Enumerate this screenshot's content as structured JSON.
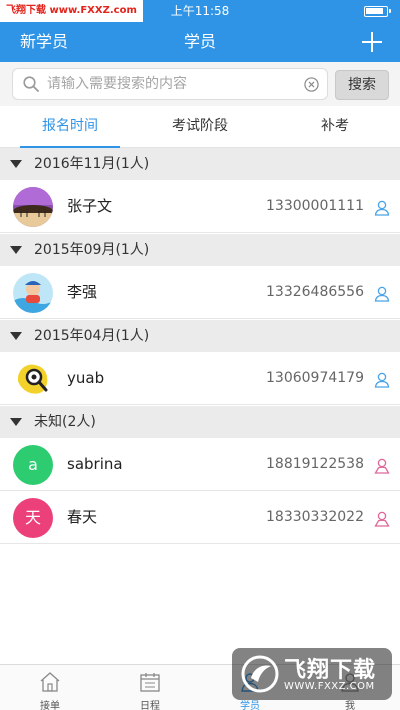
{
  "status_bar": {
    "watermark_text": "飞翔下载 www.FXXZ.com",
    "time": "上午11:58"
  },
  "nav": {
    "left_label": "新学员",
    "title": "学员",
    "add_icon": "plus-icon"
  },
  "search": {
    "placeholder": "请输入需要搜索的内容",
    "value": "",
    "button_label": "搜索"
  },
  "tabs": [
    {
      "label": "报名时间",
      "active": true
    },
    {
      "label": "考试阶段",
      "active": false
    },
    {
      "label": "补考",
      "active": false
    }
  ],
  "groups": [
    {
      "header": "2016年11月(1人)",
      "students": [
        {
          "name": "张子文",
          "phone": "13300001111",
          "gender_icon": "male-person-icon",
          "avatar": "photo"
        }
      ]
    },
    {
      "header": "2015年09月(1人)",
      "students": [
        {
          "name": "李强",
          "phone": "13326486556",
          "gender_icon": "male-person-icon",
          "avatar": "photo"
        }
      ]
    },
    {
      "header": "2015年04月(1人)",
      "students": [
        {
          "name": "yuab",
          "phone": "13060974179",
          "gender_icon": "male-person-icon",
          "avatar": "photo"
        }
      ]
    },
    {
      "header": "未知(2人)",
      "students": [
        {
          "name": "sabrina",
          "phone": "18819122538",
          "gender_icon": "female-person-icon",
          "avatar_letter": "a",
          "avatar_color": "#2ecc71"
        },
        {
          "name": "春天",
          "phone": "18330332022",
          "gender_icon": "female-person-icon",
          "avatar_letter": "天",
          "avatar_color": "#ec407a"
        }
      ]
    }
  ],
  "bottom_tabs": [
    {
      "label": "接单",
      "icon": "home-icon",
      "active": false
    },
    {
      "label": "日程",
      "icon": "calendar-icon",
      "active": false
    },
    {
      "label": "学员",
      "icon": "students-icon",
      "active": true
    },
    {
      "label": "我",
      "icon": "profile-icon",
      "active": false
    }
  ],
  "watermark": {
    "title": "飞翔下载",
    "url": "WWW.FXXZ.COM"
  },
  "colors": {
    "primary": "#2f94e6",
    "male_icon": "#4aa3e8",
    "female_icon": "#e0679a"
  }
}
